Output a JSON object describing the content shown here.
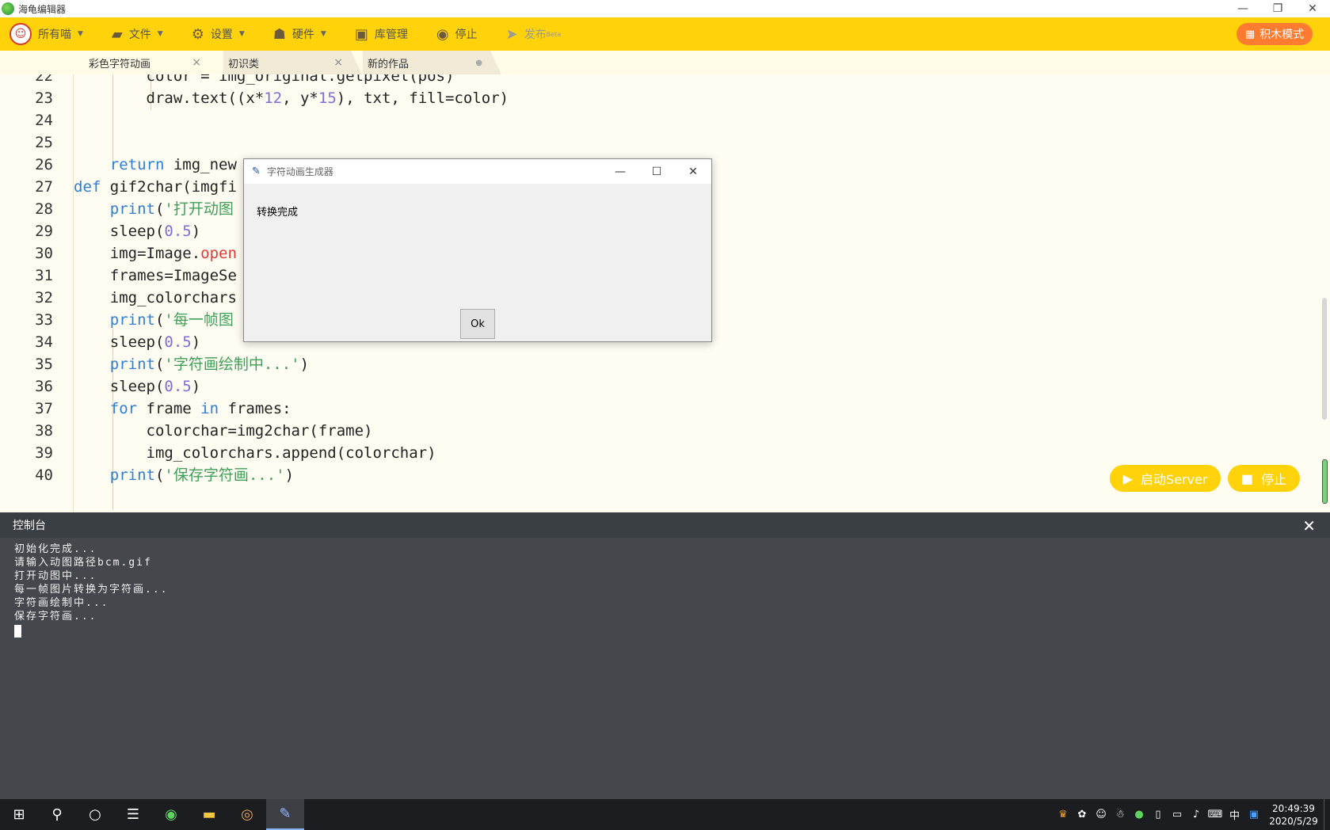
{
  "app": {
    "title": "海龟编辑器"
  },
  "window_controls": {
    "minimize": "—",
    "restore": "❐",
    "close": "✕"
  },
  "toolbar": {
    "items": [
      {
        "label": "所有喵",
        "icon": "avatar-icon",
        "caret": true
      },
      {
        "label": "文件",
        "icon": "folder-icon",
        "caret": true
      },
      {
        "label": "设置",
        "icon": "gear-icon",
        "caret": true
      },
      {
        "label": "硬件",
        "icon": "robot-icon",
        "caret": true
      },
      {
        "label": "库管理",
        "icon": "inbox-icon",
        "caret": false
      },
      {
        "label": "停止",
        "icon": "stop-icon",
        "caret": false
      },
      {
        "label": "发布",
        "icon": "send-icon",
        "caret": false,
        "badge": "Beta"
      }
    ],
    "blocks_mode": "积木模式"
  },
  "tabs": [
    {
      "label": "彩色字符动画",
      "active": true,
      "close": "×"
    },
    {
      "label": "初识类",
      "active": false,
      "close": "×"
    },
    {
      "label": "新的作品",
      "active": false,
      "close": "●"
    }
  ],
  "editor": {
    "lines": [
      {
        "n": "22",
        "html": "        color = img_original.getpixel(pos)"
      },
      {
        "n": "23",
        "html": "        draw.text((x*<span class=\"num\">12</span>, y*<span class=\"num\">15</span>), txt, fill=color)"
      },
      {
        "n": "24",
        "html": ""
      },
      {
        "n": "25",
        "html": ""
      },
      {
        "n": "26",
        "html": "    <span class=\"kw\">return</span> img_new"
      },
      {
        "n": "27",
        "html": "<span class=\"kw\">def</span> gif2char(imgfi"
      },
      {
        "n": "28",
        "html": "    <span class=\"kw\">print</span>(<span class=\"str\">'打开动图</span>"
      },
      {
        "n": "29",
        "html": "    sleep(<span class=\"num\">0.5</span>)"
      },
      {
        "n": "30",
        "html": "    img=Image.<span class=\"red\">open</span>"
      },
      {
        "n": "31",
        "html": "    frames=ImageSe"
      },
      {
        "n": "32",
        "html": "    img_colorchars"
      },
      {
        "n": "33",
        "html": "    <span class=\"kw\">print</span>(<span class=\"str\">'每一帧图</span>"
      },
      {
        "n": "34",
        "html": "    sleep(<span class=\"num\">0.5</span>)"
      },
      {
        "n": "35",
        "html": "    <span class=\"kw\">print</span>(<span class=\"str\">'字符画绘制中...'</span>)"
      },
      {
        "n": "36",
        "html": "    sleep(<span class=\"num\">0.5</span>)"
      },
      {
        "n": "37",
        "html": "    <span class=\"kw\">for</span> frame <span class=\"kw\">in</span> frames:"
      },
      {
        "n": "38",
        "html": "        colorchar=img2char(frame)"
      },
      {
        "n": "39",
        "html": "        img_colorchars.append(colorchar)"
      },
      {
        "n": "40",
        "html": "    <span class=\"kw\">print</span>(<span class=\"str\">'保存字符画...'</span>)"
      }
    ]
  },
  "server": {
    "start": "启动Server",
    "stop": "停止"
  },
  "console": {
    "title": "控制台",
    "close": "✕",
    "lines": [
      "初始化完成...",
      "请输入动图路径bcm.gif",
      "打开动图中...",
      "每一帧图片转换为字符画...",
      "字符画绘制中...",
      "保存字符画..."
    ]
  },
  "dialog": {
    "title": "字符动画生成器",
    "message": "转换完成",
    "ok": "Ok",
    "controls": {
      "minimize": "—",
      "maximize": "☐",
      "close": "✕"
    }
  },
  "taskbar": {
    "apps": [
      "windows-start-icon",
      "search-icon",
      "cortana-icon",
      "task-view-icon",
      "turtle-editor-icon",
      "file-explorer-icon",
      "browser-icon",
      "python-feather-icon"
    ],
    "ime": "中",
    "time": "20:49:39",
    "date": "2020/5/29"
  }
}
